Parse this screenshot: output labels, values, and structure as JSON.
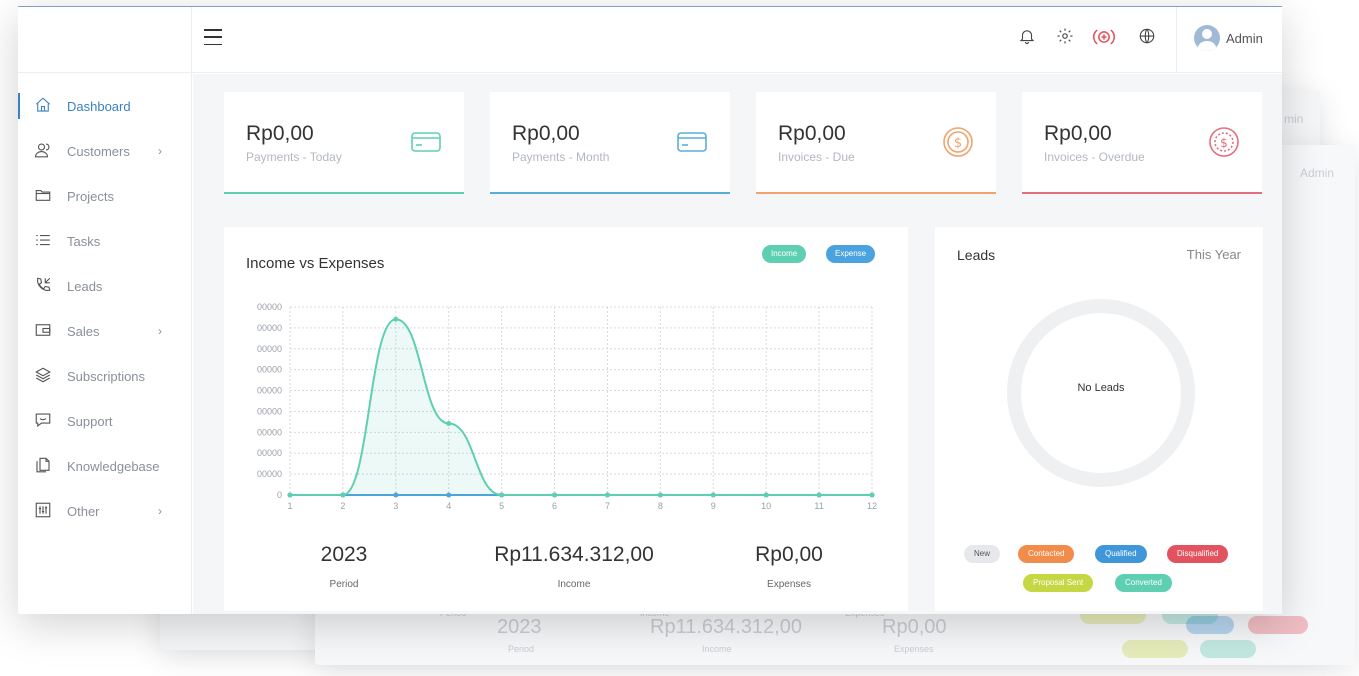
{
  "header": {
    "user_name": "Admin",
    "icons": [
      "bell-icon",
      "gear-icon",
      "add-circle-icon",
      "globe-icon"
    ]
  },
  "sidebar": {
    "items": [
      {
        "label": "Dashboard",
        "icon": "home-icon",
        "has_children": false,
        "active": true
      },
      {
        "label": "Customers",
        "icon": "users-icon",
        "has_children": true,
        "active": false
      },
      {
        "label": "Projects",
        "icon": "folder-icon",
        "has_children": false,
        "active": false
      },
      {
        "label": "Tasks",
        "icon": "list-icon",
        "has_children": false,
        "active": false
      },
      {
        "label": "Leads",
        "icon": "phone-incoming-icon",
        "has_children": false,
        "active": false
      },
      {
        "label": "Sales",
        "icon": "wallet-icon",
        "has_children": true,
        "active": false
      },
      {
        "label": "Subscriptions",
        "icon": "layers-icon",
        "has_children": false,
        "active": false
      },
      {
        "label": "Support",
        "icon": "chat-icon",
        "has_children": false,
        "active": false
      },
      {
        "label": "Knowledgebase",
        "icon": "documents-icon",
        "has_children": false,
        "active": false
      },
      {
        "label": "Other",
        "icon": "sliders-icon",
        "has_children": true,
        "active": false
      }
    ]
  },
  "stats": [
    {
      "value": "Rp0,00",
      "label": "Payments - Today",
      "icon": "credit-card-icon",
      "color": "#5fcfb2"
    },
    {
      "value": "Rp0,00",
      "label": "Payments - Month",
      "icon": "credit-card-icon",
      "color": "#5aaed6"
    },
    {
      "value": "Rp0,00",
      "label": "Invoices - Due",
      "icon": "dollar-coin-icon",
      "color": "#f0a36b"
    },
    {
      "value": "Rp0,00",
      "label": "Invoices - Overdue",
      "icon": "dollar-coin-dotted-icon",
      "color": "#e46e7d"
    }
  ],
  "chart": {
    "title": "Income vs Expenses",
    "legend": [
      {
        "label": "Income",
        "color": "#5fcfb2"
      },
      {
        "label": "Expense",
        "color": "#4aa3df"
      }
    ],
    "y_tick_labels": [
      "00000",
      "00000",
      "00000",
      "00000",
      "00000",
      "00000",
      "00000",
      "00000",
      "00000",
      "0"
    ],
    "summary": [
      {
        "value": "2023",
        "label": "Period"
      },
      {
        "value": "Rp11.634.312,00",
        "label": "Income"
      },
      {
        "value": "Rp0,00",
        "label": "Expenses"
      }
    ]
  },
  "chart_data": {
    "type": "line",
    "x": [
      1,
      2,
      3,
      4,
      5,
      6,
      7,
      8,
      9,
      10,
      11,
      12
    ],
    "series": [
      {
        "name": "Income",
        "values": [
          0,
          0,
          8600000,
          3500000,
          0,
          0,
          0,
          0,
          0,
          0,
          0,
          0
        ],
        "color": "#5fcfb2"
      },
      {
        "name": "Expense",
        "values": [
          0,
          0,
          0,
          0,
          0,
          0,
          0,
          0,
          0,
          0,
          0,
          0
        ],
        "color": "#4aa3df"
      }
    ],
    "ylim": [
      0,
      9200000
    ],
    "grid": true
  },
  "leads": {
    "title": "Leads",
    "period": "This Year",
    "empty_label": "No Leads",
    "statuses": [
      {
        "label": "New",
        "color": "#e6e8eb",
        "text_color": "#555555"
      },
      {
        "label": "Contacted",
        "color": "#f28c4a",
        "text_color": "#ffffff"
      },
      {
        "label": "Qualified",
        "color": "#3f97d9",
        "text_color": "#ffffff"
      },
      {
        "label": "Disqualified",
        "color": "#e3525f",
        "text_color": "#ffffff"
      },
      {
        "label": "Proposal Sent",
        "color": "#c5d843",
        "text_color": "#ffffff"
      },
      {
        "label": "Converted",
        "color": "#5fcfb2",
        "text_color": "#ffffff"
      }
    ]
  },
  "ghost": {
    "texts": [
      "min",
      "Admin",
      "Period",
      "Income",
      "Expenses",
      "2023",
      "Rp11.634.312,00",
      "Rp0,00",
      "Period",
      "Income",
      "Expenses"
    ]
  }
}
